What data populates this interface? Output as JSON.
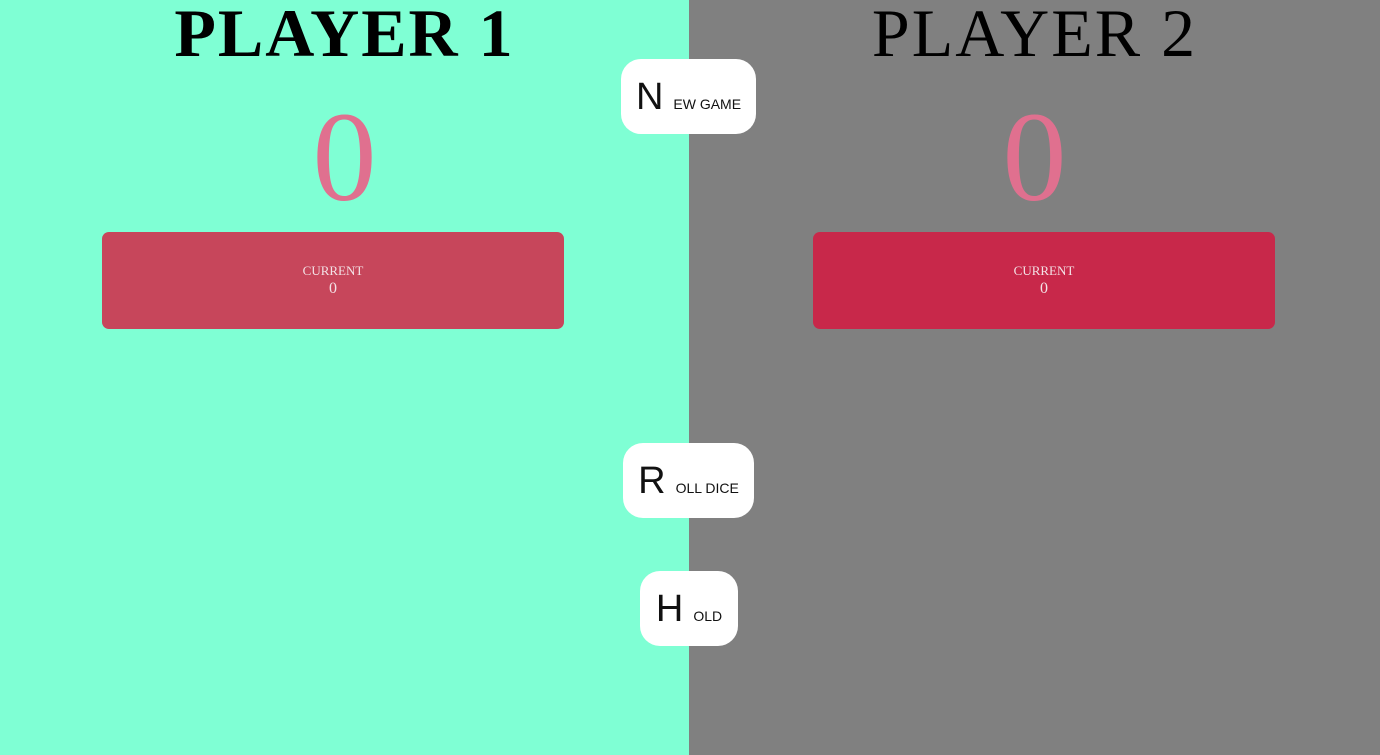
{
  "players": [
    {
      "name": "PLAYER 1",
      "score": "0",
      "current_label": "Current",
      "current_score": "0"
    },
    {
      "name": "PLAYER 2",
      "score": "0",
      "current_label": "Current",
      "current_score": "0"
    }
  ],
  "buttons": {
    "new_game": {
      "first": "N",
      "rest": "EW GAME"
    },
    "roll_dice": {
      "first": "R",
      "rest": "OLL DICE"
    },
    "hold": {
      "first": "H",
      "rest": "OLD"
    }
  },
  "colors": {
    "player1_bg": "#7fffd4",
    "player2_bg": "#808080",
    "score_color": "#e0708f",
    "current_box_player1": "#c7465b",
    "current_box_player2": "#c8284a",
    "button_bg": "#ffffff"
  }
}
